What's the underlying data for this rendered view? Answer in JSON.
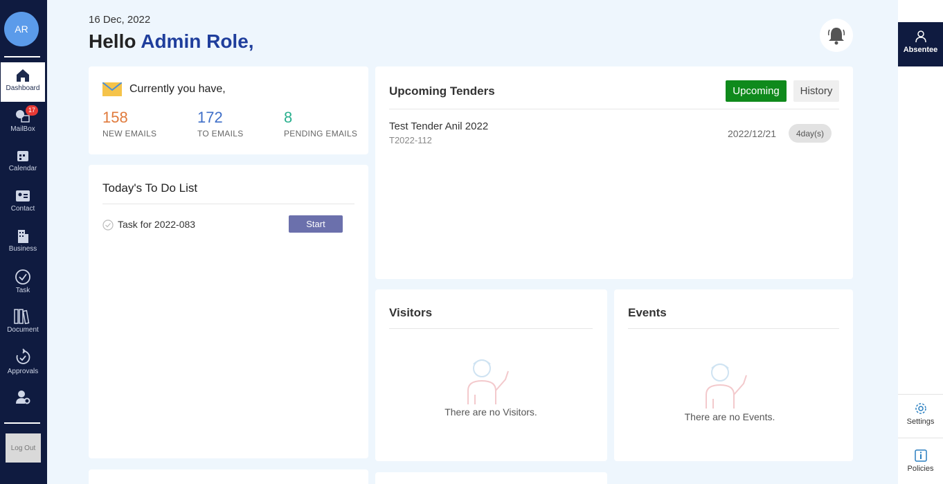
{
  "sidebar": {
    "avatar": "AR",
    "items": [
      {
        "label": "Dashboard",
        "icon": "home-icon"
      },
      {
        "label": "MailBox",
        "icon": "mailbox-icon",
        "badge": "17"
      },
      {
        "label": "Calendar",
        "icon": "calendar-icon"
      },
      {
        "label": "Contact",
        "icon": "contact-card-icon"
      },
      {
        "label": "Business",
        "icon": "building-icon"
      },
      {
        "label": "Task",
        "icon": "check-circle-icon"
      },
      {
        "label": "Document",
        "icon": "binders-icon"
      },
      {
        "label": "Approvals",
        "icon": "refresh-check-icon"
      },
      {
        "label": "",
        "icon": "user-gear-icon"
      }
    ],
    "logout": "Log Out"
  },
  "header": {
    "date": "16 Dec, 2022",
    "greeting": "Hello",
    "user": "Admin Role,"
  },
  "emails": {
    "title": "Currently you have,",
    "stats": [
      {
        "value": "158",
        "label": "NEW EMAILS",
        "color": "#e07a3c"
      },
      {
        "value": "172",
        "label": "TO EMAILS",
        "color": "#3f6fc8"
      },
      {
        "value": "8",
        "label": "PENDING EMAILS",
        "color": "#2ab08e"
      }
    ]
  },
  "todo": {
    "title": "Today's To Do List",
    "items": [
      {
        "task": "Task for 2022-083",
        "action": "Start"
      }
    ]
  },
  "tenders": {
    "title": "Upcoming Tenders",
    "tabs": {
      "upcoming": "Upcoming",
      "history": "History"
    },
    "items": [
      {
        "name": "Test Tender Anil 2022",
        "code": "T2022-112",
        "date": "2022/12/21",
        "remaining": "4day(s)"
      }
    ]
  },
  "visitors": {
    "title": "Visitors",
    "empty": "There are no Visitors."
  },
  "events": {
    "title": "Events",
    "empty": "There are no Events."
  },
  "rightbar": {
    "absentee": "Absentee",
    "settings": "Settings",
    "policies": "Policies"
  },
  "colors": {
    "navy": "#0f1b40",
    "accent": "#1f3e9c",
    "upcoming_green": "#0f8a1c",
    "start_purple": "#6b70ac"
  }
}
